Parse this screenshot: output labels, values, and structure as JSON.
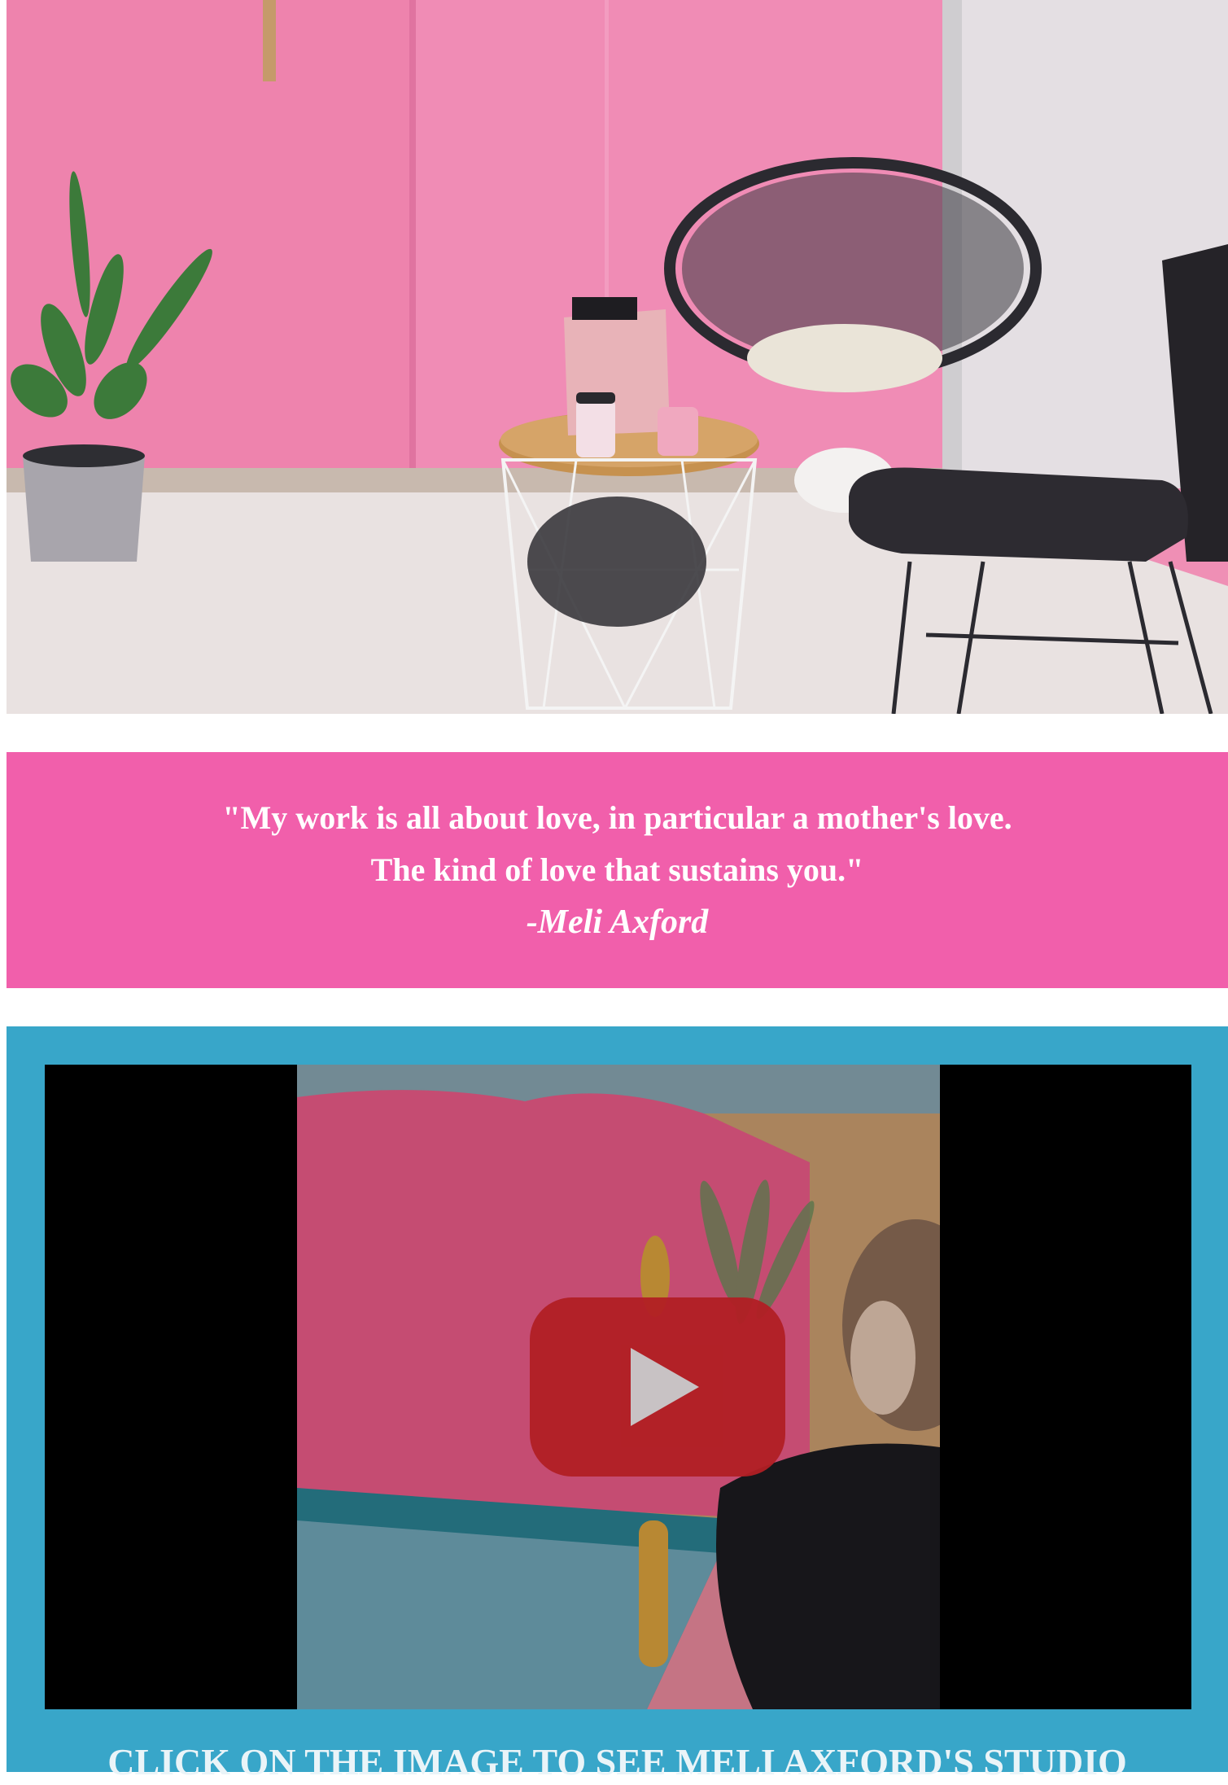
{
  "quote": {
    "line1": "\"My work is all about love, in particular a mother's love.",
    "line2": "The kind of love that sustains you.\"",
    "author": "-Meli Axford"
  },
  "video": {
    "play_icon": "youtube-play-icon",
    "cta": "CLICK ON THE IMAGE TO SEE MELI AXFORD'S STUDIO"
  },
  "colors": {
    "quote_band": "#f15fab",
    "video_band": "#38a6c9",
    "play_button": "#b11f24"
  }
}
